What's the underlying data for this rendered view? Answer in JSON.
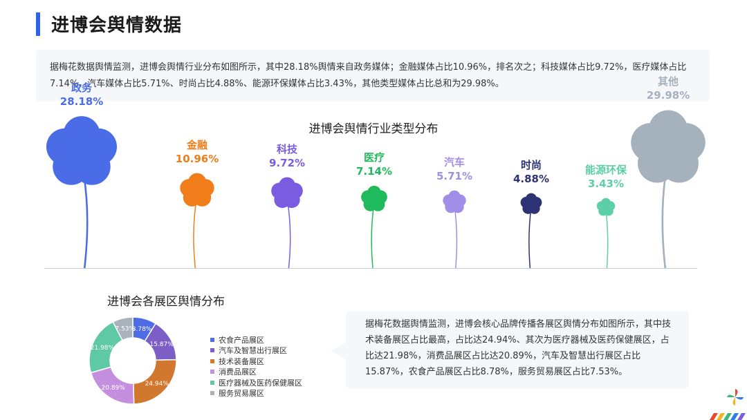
{
  "page": {
    "title": "进博会舆情数据",
    "summary": "据梅花数据舆情监测，进博会舆情行业分布如图所示，其中28.18%舆情来自政务媒体；金融媒体占比10.96%，排名次之；科技媒体占比9.72%，医疗媒体占比7.14%，汽车媒体占比5.71%、时尚占比4.88%、能源环保媒体占比3.43%，其他类型媒体占比总和为29.98%。",
    "callout": "据梅花数据舆情监测，进博会核心品牌传播各展区舆情分布如图所示，其中技术装备展区占比最高，占比达24.94%、其次为医疗器械及医药保健展区，占比达21.98%，消费品展区占比达20.89%，汽车及智慧出行展区占比15.87%，农食产品展区占比8.78%，服务贸易展区占比7.53%。"
  },
  "chart_data": [
    {
      "type": "bar",
      "title": "进博会舆情行业类型分布",
      "categories": [
        "政务",
        "金融",
        "科技",
        "医疗",
        "汽车",
        "时尚",
        "能源环保",
        "其他"
      ],
      "labels": [
        "28.18%",
        "10.96%",
        "9.72%",
        "7.14%",
        "5.71%",
        "4.88%",
        "3.43%",
        "29.98%"
      ],
      "values": [
        28.18,
        10.96,
        9.72,
        7.14,
        5.71,
        4.88,
        3.43,
        29.98
      ],
      "colors": [
        "#4a6ce6",
        "#f07d1a",
        "#7a5ce0",
        "#1fba5b",
        "#a18ee8",
        "#2c3273",
        "#5ccfa8",
        "#a6b1be"
      ],
      "unit": "%"
    },
    {
      "type": "pie",
      "title": "进博会各展区舆情分布",
      "categories": [
        "农食产品展区",
        "汽车及智慧出行展区",
        "技术装备展区",
        "消费品展区",
        "医疗器械及医药保健展区",
        "服务贸易展区"
      ],
      "values": [
        8.78,
        15.87,
        24.94,
        20.89,
        21.98,
        7.53
      ],
      "labels": [
        "8.78%",
        "15.87%",
        "24.94%",
        "20.89%",
        "21.98%",
        "7.53%"
      ],
      "colors": [
        "#4e6ce6",
        "#7d5ec6",
        "#d2772e",
        "#c58fe0",
        "#5fc8a4",
        "#a8b2bd"
      ]
    }
  ]
}
